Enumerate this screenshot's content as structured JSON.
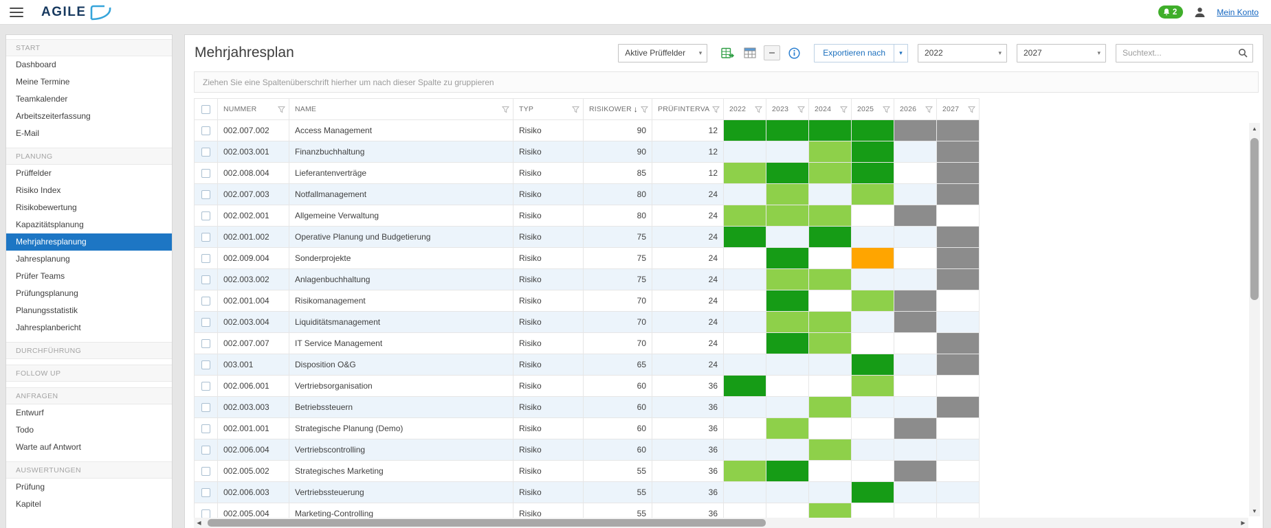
{
  "header": {
    "logo_text": "AGILE",
    "notification_count": "2",
    "account_link": "Mein Konto"
  },
  "sidebar": {
    "sections": [
      {
        "label": "START",
        "items": [
          {
            "label": "Dashboard"
          },
          {
            "label": "Meine Termine"
          },
          {
            "label": "Teamkalender"
          },
          {
            "label": "Arbeitszeiterfassung"
          },
          {
            "label": "E-Mail"
          }
        ]
      },
      {
        "label": "PLANUNG",
        "items": [
          {
            "label": "Prüffelder"
          },
          {
            "label": "Risiko Index"
          },
          {
            "label": "Risikobewertung"
          },
          {
            "label": "Kapazitätsplanung"
          },
          {
            "label": "Mehrjahresplanung",
            "selected": true
          },
          {
            "label": "Jahresplanung"
          },
          {
            "label": "Prüfer Teams"
          },
          {
            "label": "Prüfungsplanung"
          },
          {
            "label": "Planungsstatistik"
          },
          {
            "label": "Jahresplanbericht"
          }
        ]
      },
      {
        "label": "DURCHFÜHRUNG",
        "items": []
      },
      {
        "label": "FOLLOW UP",
        "items": []
      },
      {
        "label": "ANFRAGEN",
        "items": [
          {
            "label": "Entwurf"
          },
          {
            "label": "Todo"
          },
          {
            "label": "Warte auf Antwort"
          }
        ]
      },
      {
        "label": "AUSWERTUNGEN",
        "items": [
          {
            "label": "Prüfung"
          },
          {
            "label": "Kapitel"
          }
        ]
      }
    ]
  },
  "page": {
    "title": "Mehrjahresplan",
    "group_hint": "Ziehen Sie eine Spaltenüberschrift hierher um nach dieser Spalte zu gruppieren"
  },
  "toolbar": {
    "filter_select_value": "Aktive Prüffelder",
    "export_label": "Exportieren nach",
    "year_from": "2022",
    "year_to": "2027",
    "search_placeholder": "Suchtext...",
    "icons": [
      "excel-export-icon",
      "table-columns-icon",
      "collapse-icon",
      "info-icon"
    ]
  },
  "table": {
    "columns": [
      {
        "label": "NUMMER",
        "filter": true
      },
      {
        "label": "NAME",
        "filter": true
      },
      {
        "label": "TYP",
        "filter": true
      },
      {
        "label": "RISIKOWERT",
        "filter": true,
        "sort": "desc"
      },
      {
        "label": "PRÜFINTERVALL",
        "filter": true
      },
      {
        "label": "2022",
        "filter": true
      },
      {
        "label": "2023",
        "filter": true
      },
      {
        "label": "2024",
        "filter": true
      },
      {
        "label": "2025",
        "filter": true
      },
      {
        "label": "2026",
        "filter": true
      },
      {
        "label": "2027",
        "filter": true
      }
    ],
    "rows": [
      {
        "nummer": "002.007.002",
        "name": "Access Management",
        "typ": "Risiko",
        "risikowert": 90,
        "pruefintervall": 12,
        "years": [
          "dark",
          "dark",
          "dark",
          "dark",
          "gray",
          "gray"
        ]
      },
      {
        "nummer": "002.003.001",
        "name": "Finanzbuchhaltung",
        "typ": "Risiko",
        "risikowert": 90,
        "pruefintervall": 12,
        "years": [
          "",
          "",
          "light",
          "dark",
          "",
          "gray"
        ]
      },
      {
        "nummer": "002.008.004",
        "name": "Lieferantenverträge",
        "typ": "Risiko",
        "risikowert": 85,
        "pruefintervall": 12,
        "years": [
          "light",
          "dark",
          "light",
          "dark",
          "",
          "gray"
        ]
      },
      {
        "nummer": "002.007.003",
        "name": "Notfallmanagement",
        "typ": "Risiko",
        "risikowert": 80,
        "pruefintervall": 24,
        "years": [
          "",
          "light",
          "",
          "light",
          "",
          "gray"
        ]
      },
      {
        "nummer": "002.002.001",
        "name": "Allgemeine Verwaltung",
        "typ": "Risiko",
        "risikowert": 80,
        "pruefintervall": 24,
        "years": [
          "light",
          "light",
          "light",
          "",
          "gray",
          ""
        ]
      },
      {
        "nummer": "002.001.002",
        "name": "Operative Planung und Budgetierung",
        "typ": "Risiko",
        "risikowert": 75,
        "pruefintervall": 24,
        "years": [
          "dark",
          "",
          "dark",
          "",
          "",
          "gray"
        ]
      },
      {
        "nummer": "002.009.004",
        "name": "Sonderprojekte",
        "typ": "Risiko",
        "risikowert": 75,
        "pruefintervall": 24,
        "years": [
          "",
          "dark",
          "",
          "orange",
          "",
          "gray"
        ]
      },
      {
        "nummer": "002.003.002",
        "name": "Anlagenbuchhaltung",
        "typ": "Risiko",
        "risikowert": 75,
        "pruefintervall": 24,
        "years": [
          "",
          "light",
          "light",
          "",
          "",
          "gray"
        ]
      },
      {
        "nummer": "002.001.004",
        "name": "Risikomanagement",
        "typ": "Risiko",
        "risikowert": 70,
        "pruefintervall": 24,
        "years": [
          "",
          "dark",
          "",
          "light",
          "gray",
          ""
        ]
      },
      {
        "nummer": "002.003.004",
        "name": "Liquiditätsmanagement",
        "typ": "Risiko",
        "risikowert": 70,
        "pruefintervall": 24,
        "years": [
          "",
          "light",
          "light",
          "",
          "gray",
          ""
        ]
      },
      {
        "nummer": "002.007.007",
        "name": "IT Service Management",
        "typ": "Risiko",
        "risikowert": 70,
        "pruefintervall": 24,
        "years": [
          "",
          "dark",
          "light",
          "",
          "",
          "gray"
        ]
      },
      {
        "nummer": "003.001",
        "name": "Disposition O&G",
        "typ": "Risiko",
        "risikowert": 65,
        "pruefintervall": 24,
        "years": [
          "",
          "",
          "",
          "dark",
          "",
          "gray"
        ]
      },
      {
        "nummer": "002.006.001",
        "name": "Vertriebsorganisation",
        "typ": "Risiko",
        "risikowert": 60,
        "pruefintervall": 36,
        "years": [
          "dark",
          "",
          "",
          "light",
          "",
          ""
        ]
      },
      {
        "nummer": "002.003.003",
        "name": "Betriebssteuern",
        "typ": "Risiko",
        "risikowert": 60,
        "pruefintervall": 36,
        "years": [
          "",
          "",
          "light",
          "",
          "",
          "gray"
        ]
      },
      {
        "nummer": "002.001.001",
        "name": "Strategische Planung (Demo)",
        "typ": "Risiko",
        "risikowert": 60,
        "pruefintervall": 36,
        "years": [
          "",
          "light",
          "",
          "",
          "gray",
          ""
        ]
      },
      {
        "nummer": "002.006.004",
        "name": "Vertriebscontrolling",
        "typ": "Risiko",
        "risikowert": 60,
        "pruefintervall": 36,
        "years": [
          "",
          "",
          "light",
          "",
          "",
          ""
        ]
      },
      {
        "nummer": "002.005.002",
        "name": "Strategisches Marketing",
        "typ": "Risiko",
        "risikowert": 55,
        "pruefintervall": 36,
        "years": [
          "light",
          "dark",
          "",
          "",
          "gray",
          ""
        ]
      },
      {
        "nummer": "002.006.003",
        "name": "Vertriebssteuerung",
        "typ": "Risiko",
        "risikowert": 55,
        "pruefintervall": 36,
        "years": [
          "",
          "",
          "",
          "dark",
          "",
          ""
        ]
      },
      {
        "nummer": "002.005.004",
        "name": "Marketing-Controlling",
        "typ": "Risiko",
        "risikowert": 55,
        "pruefintervall": 36,
        "years": [
          "",
          "",
          "light",
          "",
          "",
          ""
        ]
      }
    ],
    "cell_colors": {
      "dark": "#169c16",
      "light": "#8ed04a",
      "orange": "#ffa500",
      "gray": "#8c8c8c"
    }
  },
  "colors": {
    "accent_blue": "#1d76c4",
    "link_blue": "#1466c0",
    "badge_green": "#3fae2a",
    "alt_row": "#ecf4fb"
  }
}
